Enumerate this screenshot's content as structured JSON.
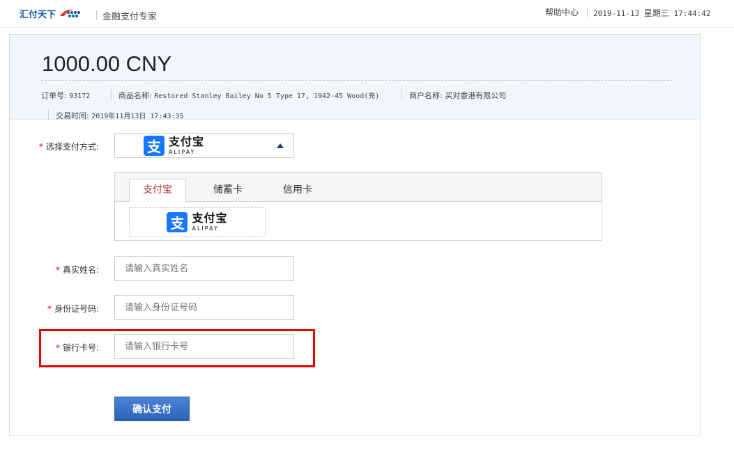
{
  "header": {
    "logo_text": "汇付天下",
    "slogan": "金融支付专家",
    "help": "帮助中心",
    "date": "2019-11-13",
    "weekday": "星期三",
    "time": "17:44:42"
  },
  "order": {
    "amount": "1000.00 CNY",
    "order_no_label": "订单号:",
    "order_no": "93172",
    "product_label": "商品名称:",
    "product": "Restored Stanley Bailey No 5 Type 17, 1942-45 Wood(充)",
    "merchant_label": "商户名称:",
    "merchant": "买对香港有限公司",
    "time_label": "交易时间:",
    "time": "2019年11月13日 17:43:35"
  },
  "form": {
    "required_mark": "*",
    "payment_method_label": "选择支付方式:",
    "payment_method_selected": {
      "cn": "支付宝",
      "en": "ALIPAY",
      "icon_char": "支"
    },
    "tabs": [
      {
        "label": "支付宝",
        "active": true
      },
      {
        "label": "储蓄卡",
        "active": false
      },
      {
        "label": "信用卡",
        "active": false
      }
    ],
    "pay_option": {
      "cn": "支付宝",
      "en": "ALIPAY",
      "icon_char": "支"
    },
    "name_label": "真实姓名:",
    "name_placeholder": "请输入真实姓名",
    "id_label": "身份证号码:",
    "id_placeholder": "请输入身份证号码",
    "card_label": "银行卡号:",
    "card_placeholder": "请输入银行卡号",
    "submit_label": "确认支付"
  },
  "colors": {
    "brand": "#1a56a6",
    "alipay": "#1677ff",
    "required": "#d8000f",
    "highlight": "#e60000",
    "submit": "#2d62b8",
    "active_tab": "#b42c2c"
  }
}
